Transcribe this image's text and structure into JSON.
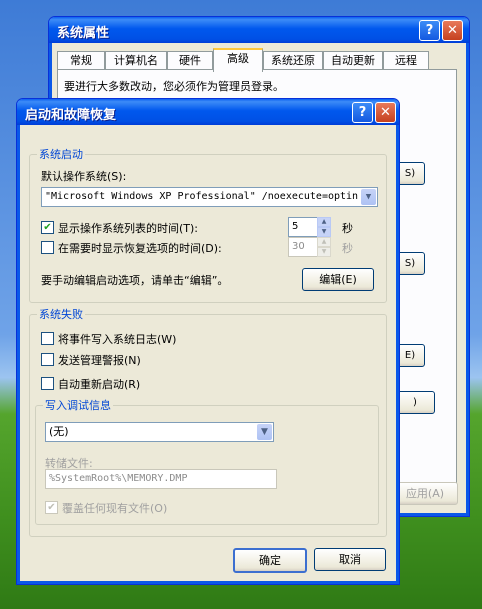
{
  "back_window": {
    "title": "系统属性",
    "tabs": [
      "常规",
      "计算机名",
      "硬件",
      "高级",
      "系统还原",
      "自动更新",
      "远程"
    ],
    "admin_note": "要进行大多数改动，您必须作为管理员登录。",
    "apply_label": "应用(A)",
    "help_icon": "question-mark-icon",
    "close_icon": "close-x-icon"
  },
  "dialog": {
    "title": "启动和故障恢复",
    "startup": {
      "group_label": "系统启动",
      "default_os_label": "默认操作系统(S):",
      "default_os_value": "\"Microsoft Windows XP Professional\" /noexecute=optin",
      "show_list_label": "显示操作系统列表的时间(T):",
      "show_list_checked": true,
      "show_list_value": "5",
      "show_recovery_label": "在需要时显示恢复选项的时间(D):",
      "show_recovery_checked": false,
      "show_recovery_value": "30",
      "seconds_unit": "秒",
      "edit_hint": "要手动编辑启动选项，请单击“编辑”。",
      "edit_button": "编辑(E)"
    },
    "failure": {
      "group_label": "系统失败",
      "write_event_label": "将事件写入系统日志(W)",
      "write_event_checked": false,
      "send_alert_label": "发送管理警报(N)",
      "send_alert_checked": false,
      "auto_restart_label": "自动重新启动(R)",
      "auto_restart_checked": false,
      "debug_group_label": "写入调试信息",
      "debug_select_value": "(无)",
      "dump_file_label": "转储文件:",
      "dump_file_value": "%SystemRoot%\\MEMORY.DMP",
      "overwrite_label": "覆盖任何现有文件(O)",
      "overwrite_checked": true
    },
    "ok_button": "确定",
    "cancel_button": "取消"
  }
}
